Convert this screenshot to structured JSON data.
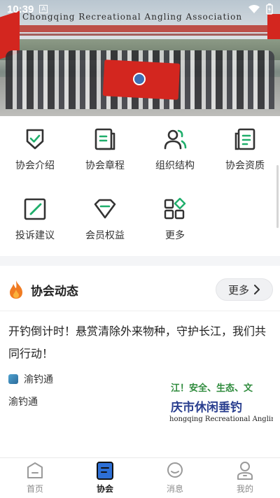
{
  "status_bar": {
    "time": "10:39",
    "notification_glyph": "A"
  },
  "hero": {
    "overlay_text": "Chongqing Recreational Angling Association",
    "icon": "group-photo"
  },
  "menu": {
    "items": [
      {
        "label": "协会介绍",
        "icon": "shield-check-icon"
      },
      {
        "label": "协会章程",
        "icon": "document-icon"
      },
      {
        "label": "组织结构",
        "icon": "people-icon"
      },
      {
        "label": "协会资质",
        "icon": "certificate-icon"
      },
      {
        "label": "投诉建议",
        "icon": "edit-icon"
      },
      {
        "label": "会员权益",
        "icon": "diamond-icon"
      },
      {
        "label": "更多",
        "icon": "grid-more-icon"
      }
    ]
  },
  "news": {
    "title": "协会动态",
    "more_label": "更多",
    "article": {
      "title": "开钓倒计时！悬赏清除外来物种，守护长江，我们共同行动！",
      "source": "渝钓通",
      "author": "渝钓通",
      "thumb_line1": "江！安全、生态、文",
      "thumb_line2": "庆市休闲垂钓",
      "thumb_line3": "hongqing Recreational Angling A"
    }
  },
  "bottom_nav": {
    "items": [
      {
        "label": "首页",
        "icon": "home-icon",
        "active": false
      },
      {
        "label": "协会",
        "icon": "association-icon",
        "active": true
      },
      {
        "label": "消息",
        "icon": "message-icon",
        "active": false
      },
      {
        "label": "我的",
        "icon": "profile-icon",
        "active": false
      }
    ]
  },
  "colors": {
    "accent": "#1fae6b",
    "brand_blue": "#2d6fd6",
    "flame": "#f07b22"
  }
}
